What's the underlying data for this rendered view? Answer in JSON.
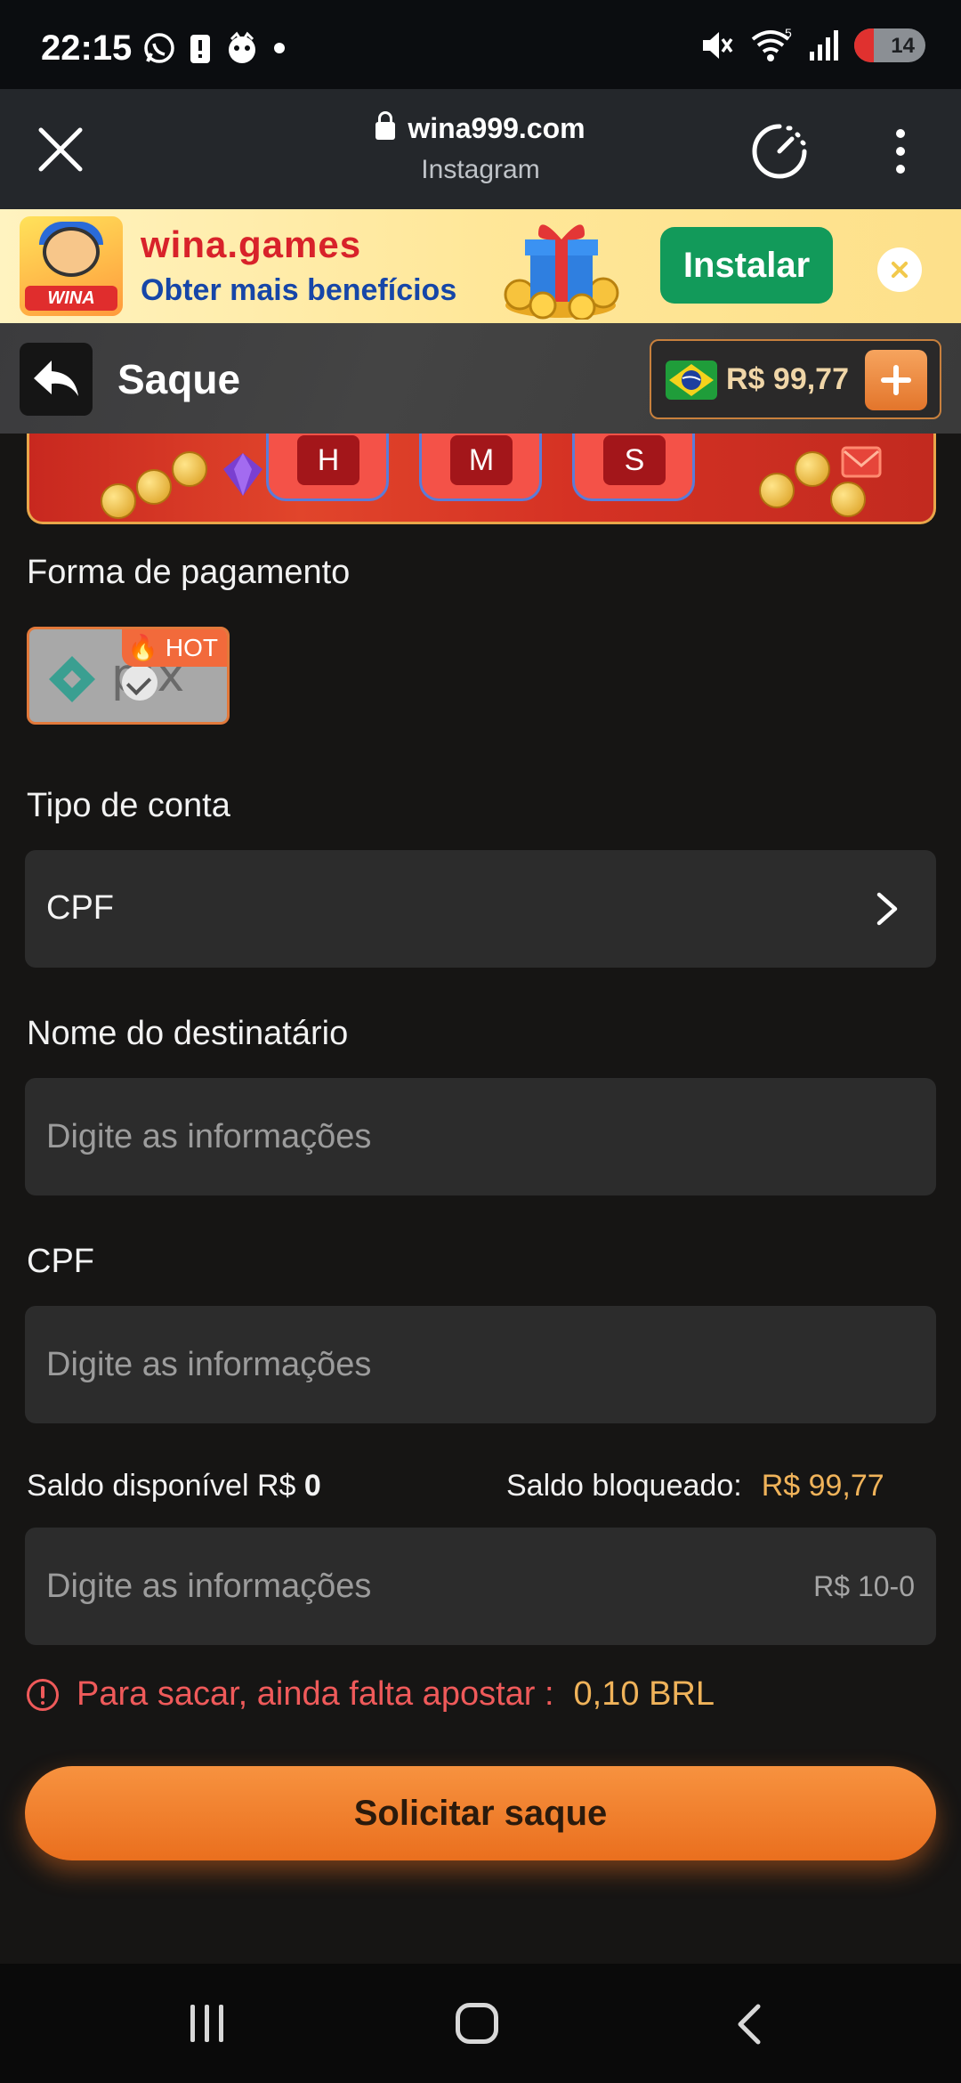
{
  "status_bar": {
    "time": "22:15",
    "battery": "14",
    "signal_badge": "5"
  },
  "browser": {
    "url": "wina999.com",
    "source": "Instagram"
  },
  "banner": {
    "title": "wina.games",
    "subtitle": "Obter mais benefícios",
    "logo_text": "WINA Games",
    "install_label": "Instalar"
  },
  "header": {
    "title": "Saque",
    "balance": "R$ 99,77"
  },
  "promo": {
    "time_labels": [
      "H",
      "M",
      "S"
    ]
  },
  "form": {
    "payment_label": "Forma de pagamento",
    "payment_method": {
      "name": "pix",
      "badge": "HOT"
    },
    "account_type_label": "Tipo de conta",
    "account_type_value": "CPF",
    "recipient_label": "Nome do destinatário",
    "recipient_placeholder": "Digite as informações",
    "cpf_label": "CPF",
    "cpf_placeholder": "Digite as informações",
    "available_label": "Saldo disponível R$",
    "available_value": "0",
    "blocked_label": "Saldo bloqueado:",
    "blocked_value": "R$ 99,77",
    "amount_placeholder": "Digite as informações",
    "amount_range": "R$ 10-0",
    "warning_text": "Para sacar, ainda falta apostar :",
    "warning_amount": "0,10 BRL",
    "submit_label": "Solicitar saque"
  },
  "colors": {
    "accent_orange": "#ea6f1e",
    "warning_red": "#ef5a5a",
    "amount_gold": "#f0b35a",
    "install_green": "#129a5a"
  }
}
